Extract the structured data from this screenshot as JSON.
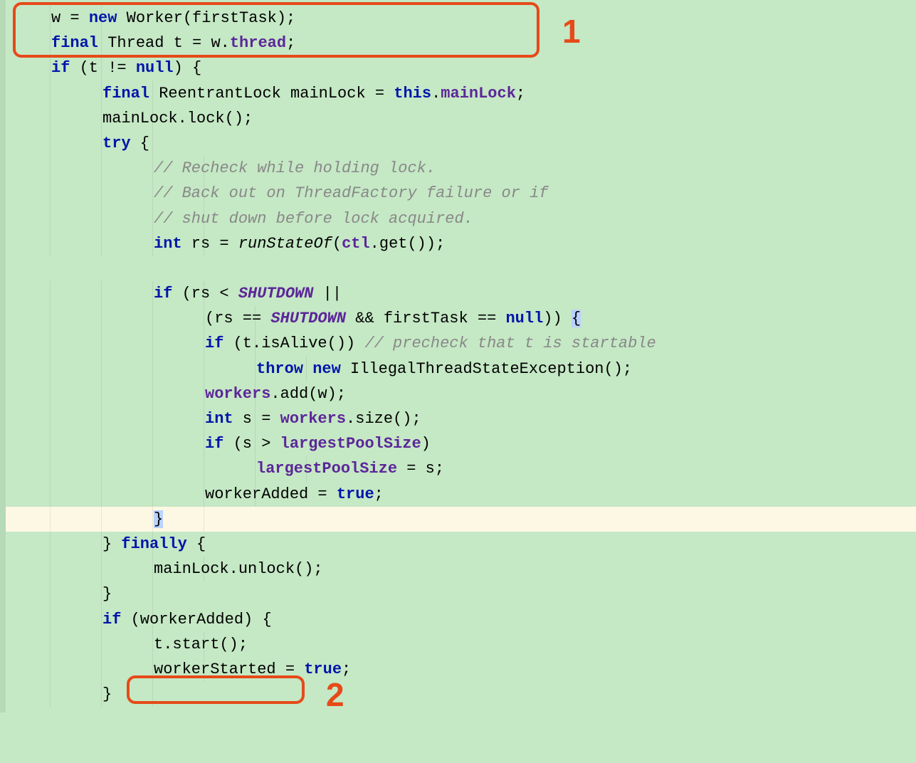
{
  "code": {
    "l1": [
      {
        "t": "w = ",
        "c": "txt"
      },
      {
        "t": "new",
        "c": "kw"
      },
      {
        "t": " Worker(firstTask);",
        "c": "txt"
      }
    ],
    "l2": [
      {
        "t": "final",
        "c": "kw"
      },
      {
        "t": " Thread t = w.",
        "c": "txt"
      },
      {
        "t": "thread",
        "c": "field"
      },
      {
        "t": ";",
        "c": "txt"
      }
    ],
    "l3": [
      {
        "t": "if",
        "c": "kw"
      },
      {
        "t": " (t != ",
        "c": "txt"
      },
      {
        "t": "null",
        "c": "kw"
      },
      {
        "t": ") {",
        "c": "txt"
      }
    ],
    "l4": [
      {
        "t": "final",
        "c": "kw"
      },
      {
        "t": " ReentrantLock mainLock = ",
        "c": "txt"
      },
      {
        "t": "this",
        "c": "kw"
      },
      {
        "t": ".",
        "c": "txt"
      },
      {
        "t": "mainLock",
        "c": "field"
      },
      {
        "t": ";",
        "c": "txt"
      }
    ],
    "l5": [
      {
        "t": "mainLock.lock();",
        "c": "txt"
      }
    ],
    "l6": [
      {
        "t": "try",
        "c": "kw"
      },
      {
        "t": " {",
        "c": "txt"
      }
    ],
    "l7": [
      {
        "t": "// Recheck while holding lock.",
        "c": "comment"
      }
    ],
    "l8": [
      {
        "t": "// Back out on ThreadFactory failure or if",
        "c": "comment"
      }
    ],
    "l9": [
      {
        "t": "// shut down before lock acquired.",
        "c": "comment"
      }
    ],
    "l10": [
      {
        "t": "int",
        "c": "kw"
      },
      {
        "t": " rs = ",
        "c": "txt"
      },
      {
        "t": "runStateOf",
        "c": "method-it"
      },
      {
        "t": "(",
        "c": "txt"
      },
      {
        "t": "ctl",
        "c": "field"
      },
      {
        "t": ".get());",
        "c": "txt"
      }
    ],
    "l11": [
      {
        "t": "if",
        "c": "kw"
      },
      {
        "t": " (rs < ",
        "c": "txt"
      },
      {
        "t": "SHUTDOWN",
        "c": "static-it"
      },
      {
        "t": " ||",
        "c": "txt"
      }
    ],
    "l12": [
      {
        "t": "(rs == ",
        "c": "txt"
      },
      {
        "t": "SHUTDOWN",
        "c": "static-it"
      },
      {
        "t": " && firstTask == ",
        "c": "txt"
      },
      {
        "t": "null",
        "c": "kw"
      },
      {
        "t": ")) ",
        "c": "txt"
      },
      {
        "t": "{",
        "c": "txt brace-match"
      }
    ],
    "l13": [
      {
        "t": "if",
        "c": "kw"
      },
      {
        "t": " (t.isAlive()) ",
        "c": "txt"
      },
      {
        "t": "// precheck that t is startable",
        "c": "comment"
      }
    ],
    "l14": [
      {
        "t": "throw new",
        "c": "kw"
      },
      {
        "t": " IllegalThreadStateException();",
        "c": "txt"
      }
    ],
    "l15": [
      {
        "t": "workers",
        "c": "field"
      },
      {
        "t": ".add(w);",
        "c": "txt"
      }
    ],
    "l16": [
      {
        "t": "int",
        "c": "kw"
      },
      {
        "t": " s = ",
        "c": "txt"
      },
      {
        "t": "workers",
        "c": "field"
      },
      {
        "t": ".size();",
        "c": "txt"
      }
    ],
    "l17": [
      {
        "t": "if",
        "c": "kw"
      },
      {
        "t": " (s > ",
        "c": "txt"
      },
      {
        "t": "largestPoolSize",
        "c": "field"
      },
      {
        "t": ")",
        "c": "txt"
      }
    ],
    "l18": [
      {
        "t": "largestPoolSize",
        "c": "field"
      },
      {
        "t": " = s;",
        "c": "txt"
      }
    ],
    "l19": [
      {
        "t": "workerAdded = ",
        "c": "txt"
      },
      {
        "t": "true",
        "c": "kw"
      },
      {
        "t": ";",
        "c": "txt"
      }
    ],
    "l20": [
      {
        "t": "}",
        "c": "txt brace-match"
      }
    ],
    "l21": [
      {
        "t": "} ",
        "c": "txt"
      },
      {
        "t": "finally",
        "c": "kw"
      },
      {
        "t": " {",
        "c": "txt"
      }
    ],
    "l22": [
      {
        "t": "mainLock.unlock();",
        "c": "txt"
      }
    ],
    "l23": [
      {
        "t": "}",
        "c": "txt"
      }
    ],
    "l24": [
      {
        "t": "if",
        "c": "kw"
      },
      {
        "t": " (workerAdded) {",
        "c": "txt"
      }
    ],
    "l25": [
      {
        "t": "t.start();",
        "c": "txt"
      }
    ],
    "l26": [
      {
        "t": "workerStarted = ",
        "c": "txt"
      },
      {
        "t": "true",
        "c": "kw"
      },
      {
        "t": ";",
        "c": "txt"
      }
    ],
    "l27": [
      {
        "t": "}",
        "c": "txt"
      }
    ]
  },
  "indents": {
    "l1": 0,
    "l2": 0,
    "l3": 0,
    "l4": 1,
    "l5": 1,
    "l6": 1,
    "l7": 2,
    "l8": 2,
    "l9": 2,
    "l10": 2,
    "l11": 2,
    "l12": 3,
    "l13": 3,
    "l14": 4,
    "l15": 3,
    "l16": 3,
    "l17": 3,
    "l18": 4,
    "l19": 3,
    "l20": 2,
    "l21": 1,
    "l22": 2,
    "l23": 1,
    "l24": 1,
    "l25": 2,
    "l26": 2,
    "l27": 1
  },
  "annotations": {
    "label1": "1",
    "label2": "2"
  }
}
